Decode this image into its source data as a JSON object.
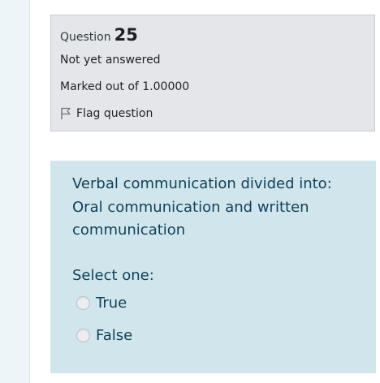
{
  "question_info": {
    "question_word": "Question",
    "question_number": "25",
    "state": "Not yet answered",
    "grade": "Marked out of 1.00000",
    "flag_label": "Flag question",
    "flag_icon": "flag-outline-icon"
  },
  "question": {
    "text": "Verbal communication divided into: Oral communication and written communication",
    "prompt": "Select one:",
    "options": [
      {
        "label": "True",
        "selected": false
      },
      {
        "label": "False",
        "selected": false
      }
    ]
  },
  "colors": {
    "info_background": "#e4e6e9",
    "question_background": "#d0e6ec",
    "question_text": "#113f59"
  }
}
